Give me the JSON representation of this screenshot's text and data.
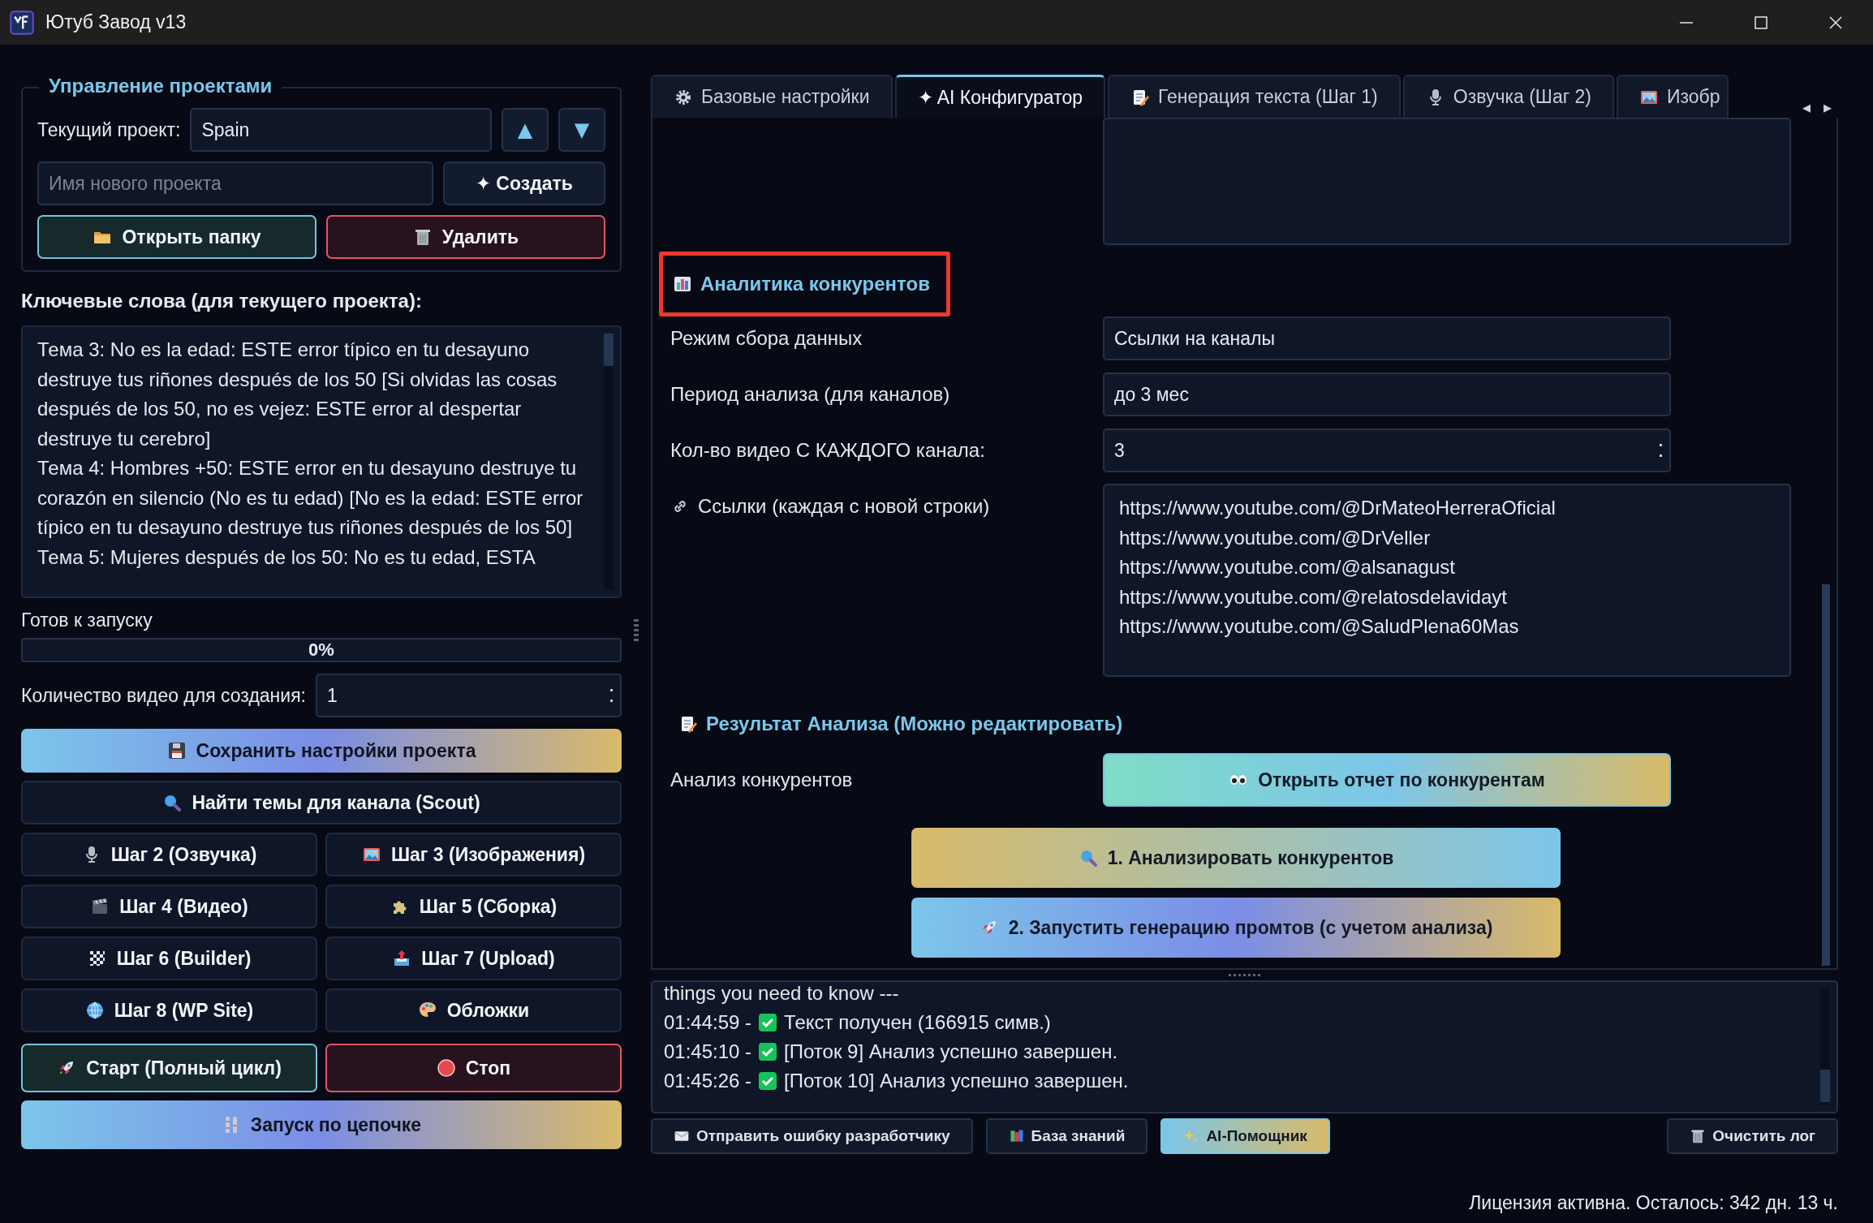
{
  "window": {
    "title": "Ютуб Завод v13"
  },
  "projects": {
    "title": "Управление проектами",
    "current_label": "Текущий проект:",
    "current": "Spain",
    "up": "▲",
    "down": "▼",
    "new_placeholder": "Имя нового проекта",
    "create_icon": "✦",
    "create": "Создать",
    "open_folder": "Открыть папку",
    "delete": "Удалить"
  },
  "keywords": {
    "label": "Ключевые слова (для текущего проекта):",
    "lines": [
      "Тема 3: No es la edad: ESTE error típico en tu desayuno destruye tus riñones después de los 50 [Si olvidas las cosas después de los 50, no es vejez: ESTE error al despertar destruye tu cerebro]",
      "Тема 4: Hombres +50: ESTE error en tu desayuno destruye tu corazón en silencio (No es tu edad) [No es la edad: ESTE error típico en tu desayuno destruye tus riñones después de los 50]",
      "Тема 5: Mujeres después de los 50: No es tu edad, ESTA"
    ]
  },
  "status": "Готов к запуску",
  "progress": {
    "level": 0,
    "text": "0%"
  },
  "count": {
    "label": "Количество видео для создания:",
    "value": "1"
  },
  "actions": [
    {
      "label": "Сохранить настройки проекта",
      "kind": "gradient",
      "wide": true
    },
    {
      "label": "Найти темы для канала (Scout)",
      "kind": "plain",
      "wide": true
    },
    {
      "label": "Шаг 2 (Озвучка)",
      "kind": "plain",
      "wide": false
    },
    {
      "label": "Шаг 3 (Изображения)",
      "kind": "plain",
      "wide": false
    },
    {
      "label": "Шаг 4 (Видео)",
      "kind": "plain",
      "wide": false
    },
    {
      "label": "Шаг 5 (Сборка)",
      "kind": "plain",
      "wide": false
    },
    {
      "label": "Шаг 6 (Builder)",
      "kind": "plain",
      "wide": false
    },
    {
      "label": "Шаг 7 (Upload)",
      "kind": "plain",
      "wide": false
    },
    {
      "label": "Шаг 8 (WP Site)",
      "kind": "plain",
      "wide": false
    },
    {
      "label": "Обложки",
      "kind": "plain",
      "wide": false
    },
    {
      "label": "Старт (Полный цикл)",
      "kind": "start",
      "wide": false
    },
    {
      "label": "Стоп",
      "kind": "stop",
      "wide": false
    },
    {
      "label": "Запуск по цепочке",
      "kind": "gradient",
      "wide": true
    }
  ],
  "tabs": [
    {
      "label": "Базовые настройки",
      "selected": false
    },
    {
      "label": "✦ AI Конфигуратор",
      "selected": true
    },
    {
      "label": "Генерация текста (Шаг 1)",
      "selected": false
    },
    {
      "label": "Озвучка (Шаг 2)",
      "selected": false
    },
    {
      "label": "Изобр",
      "selected": false
    }
  ],
  "tab_scroll": [
    "◂",
    "▸"
  ],
  "competitors": {
    "heading": "Аналитика конкурентов",
    "highlighted": true,
    "fields": [
      {
        "label": "Режим сбора данных",
        "value": "Ссылки на каналы",
        "kind": "combo"
      },
      {
        "label": "Период анализа (для каналов)",
        "value": "до 3 мес",
        "kind": "combo"
      },
      {
        "label": "Кол-во видео С КАЖДОГО канала:",
        "value": "3",
        "kind": "spin"
      }
    ],
    "links_label": "Ссылки (каждая с новой строки)",
    "links": [
      "https://www.youtube.com/@DrMateoHerreraOficial",
      "https://www.youtube.com/@DrVeller",
      "https://www.youtube.com/@alsanagust",
      "https://www.youtube.com/@relatosdelavidayt",
      "https://www.youtube.com/@SaludPlena60Mas"
    ],
    "result_heading": "Результат Анализа (Можно редактировать)",
    "report_label": "Анализ конкурентов",
    "report_button": "Открыть отчет по конкурентам",
    "buttons": [
      {
        "label": "1. Анализировать конкурентов",
        "kind": "gold"
      },
      {
        "label": "2. Запустить генерацию промтов (с учетом анализа)",
        "kind": "blue"
      }
    ]
  },
  "log": [
    {
      "text": "things you need to know ---",
      "ok": false
    },
    {
      "time": "01:44:59 -",
      "text": "Текст получен (166915 симв.)",
      "ok": true
    },
    {
      "time": "01:45:10 -",
      "text": "[Поток 9] Анализ успешно завершен.",
      "ok": true
    },
    {
      "time": "01:45:26 -",
      "text": "[Поток 10] Анализ успешно завершен.",
      "ok": true
    }
  ],
  "log_buttons": [
    {
      "label": "Отправить ошибку разработчику",
      "kind": "plain"
    },
    {
      "label": "База знаний",
      "kind": "plain"
    },
    {
      "label": "AI-Помощник",
      "kind": "accent"
    },
    {
      "label": "Очистить лог",
      "kind": "right"
    }
  ],
  "status_bar": "Лицензия активна. Осталось: 342 дн. 13 ч."
}
